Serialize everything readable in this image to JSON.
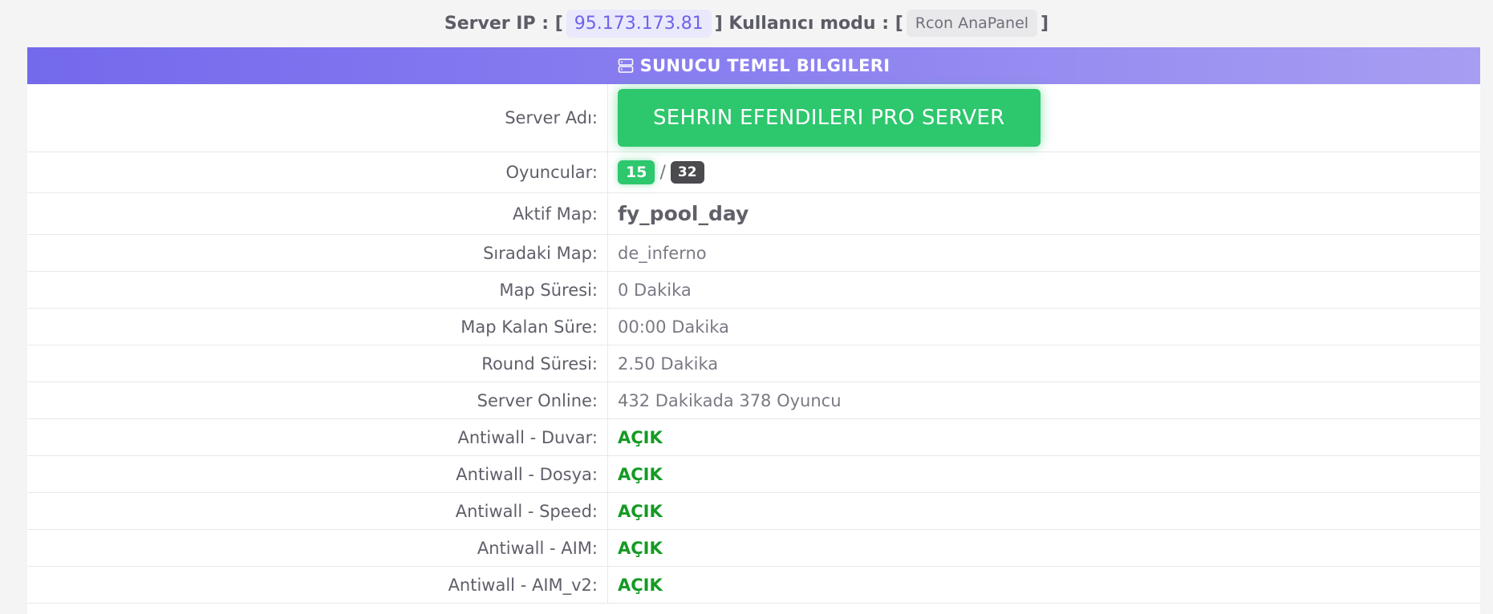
{
  "topbar": {
    "ip_label": "Server IP : [",
    "ip": "95.173.173.81",
    "mode_label": "] Kullanıcı modu : [",
    "mode": "Rcon AnaPanel",
    "close": "]"
  },
  "panel": {
    "header_icon": "server-icon",
    "header_title": "SUNUCU TEMEL BILGILERI",
    "accent_color": "#7469ec"
  },
  "rows": {
    "server_name": {
      "label": "Server Adı:",
      "value": "SEHRIN EFENDILERI PRO SERVER"
    },
    "players": {
      "label": "Oyuncular:",
      "current": "15",
      "sep": "/",
      "max": "32"
    },
    "active_map": {
      "label": "Aktif Map:",
      "value": "fy_pool_day"
    },
    "next_map": {
      "label": "Sıradaki Map:",
      "value": "de_inferno"
    },
    "map_time": {
      "label": "Map Süresi:",
      "value": "0 Dakika"
    },
    "map_remaining": {
      "label": "Map Kalan Süre:",
      "value": "00:00 Dakika"
    },
    "round_time": {
      "label": "Round Süresi:",
      "value": "2.50 Dakika"
    },
    "server_online": {
      "label": "Server Online:",
      "value": "432 Dakikada 378 Oyuncu"
    },
    "antiwall_duvar": {
      "label": "Antiwall - Duvar:",
      "value": "AÇIK"
    },
    "antiwall_dosya": {
      "label": "Antiwall - Dosya:",
      "value": "AÇIK"
    },
    "antiwall_speed": {
      "label": "Antiwall - Speed:",
      "value": "AÇIK"
    },
    "antiwall_aim": {
      "label": "Antiwall - AIM:",
      "value": "AÇIK"
    },
    "antiwall_aim_v2": {
      "label": "Antiwall - AIM_v2:",
      "value": "AÇIK"
    }
  },
  "colors": {
    "success": "#2dc76d",
    "status_on": "#149a23",
    "dark_badge": "#4a4a4f"
  }
}
